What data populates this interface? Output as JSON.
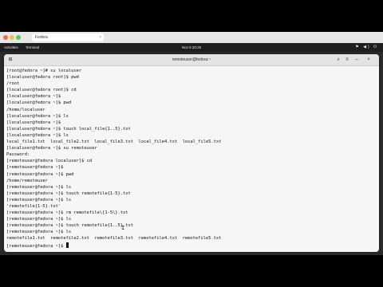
{
  "browser": {
    "tab_title": "Fedora",
    "tab_close": "×"
  },
  "topbar": {
    "activities": "Activities",
    "app_name": "Terminal",
    "clock": "Nov 8  20:25",
    "tray": "⚑ ◀) ⏻"
  },
  "terminal": {
    "title": "remoteuser@fedora:~",
    "buttons": {
      "new_tab": "⊞",
      "search": "⌕",
      "menu": "≡",
      "minimize": "–",
      "close": "×"
    },
    "lines": [
      "[root@fedora ~]# su localuser",
      "[localuser@fedora root]$ pwd",
      "/root",
      "[localuser@fedora root]$ cd",
      "[localuser@fedora ~]$",
      "[localuser@fedora ~]$ pwd",
      "/home/localuser",
      "[localuser@fedora ~]$ ls",
      "[localuser@fedora ~]$",
      "[localuser@fedora ~]$ touch local_file{1..5}.txt",
      "[localuser@fedora ~]$ ls",
      "local_file1.txt  local_file2.txt  local_file3.txt  local_file4.txt  local_file5.txt",
      "[localuser@fedora ~]$ su remoteuser",
      "Password:",
      "[remoteuser@fedora localuser]$ cd",
      "[remoteuser@fedora ~]$",
      "[remoteuser@fedora ~]$ pwd",
      "/home/remoteuser",
      "[remoteuser@fedora ~]$ ls",
      "[remoteuser@fedora ~]$ touch remotefile{1-5}.txt",
      "[remoteuser@fedora ~]$ ls",
      "'remotefile{1-5}.txt'",
      "[remoteuser@fedora ~]$ rm remotefile\\{1-5\\}.txt",
      "[remoteuser@fedora ~]$ ls",
      "[remoteuser@fedora ~]$ touch remotefile{1..5}.txt",
      "[remoteuser@fedora ~]$ ls",
      "remotefile1.txt  remotefile2.txt  remotefile3.txt  remotefile4.txt  remotefile5.txt"
    ],
    "prompt": "[remoteuser@fedora ~]$ "
  },
  "mouse_cursor_glyph": "I"
}
